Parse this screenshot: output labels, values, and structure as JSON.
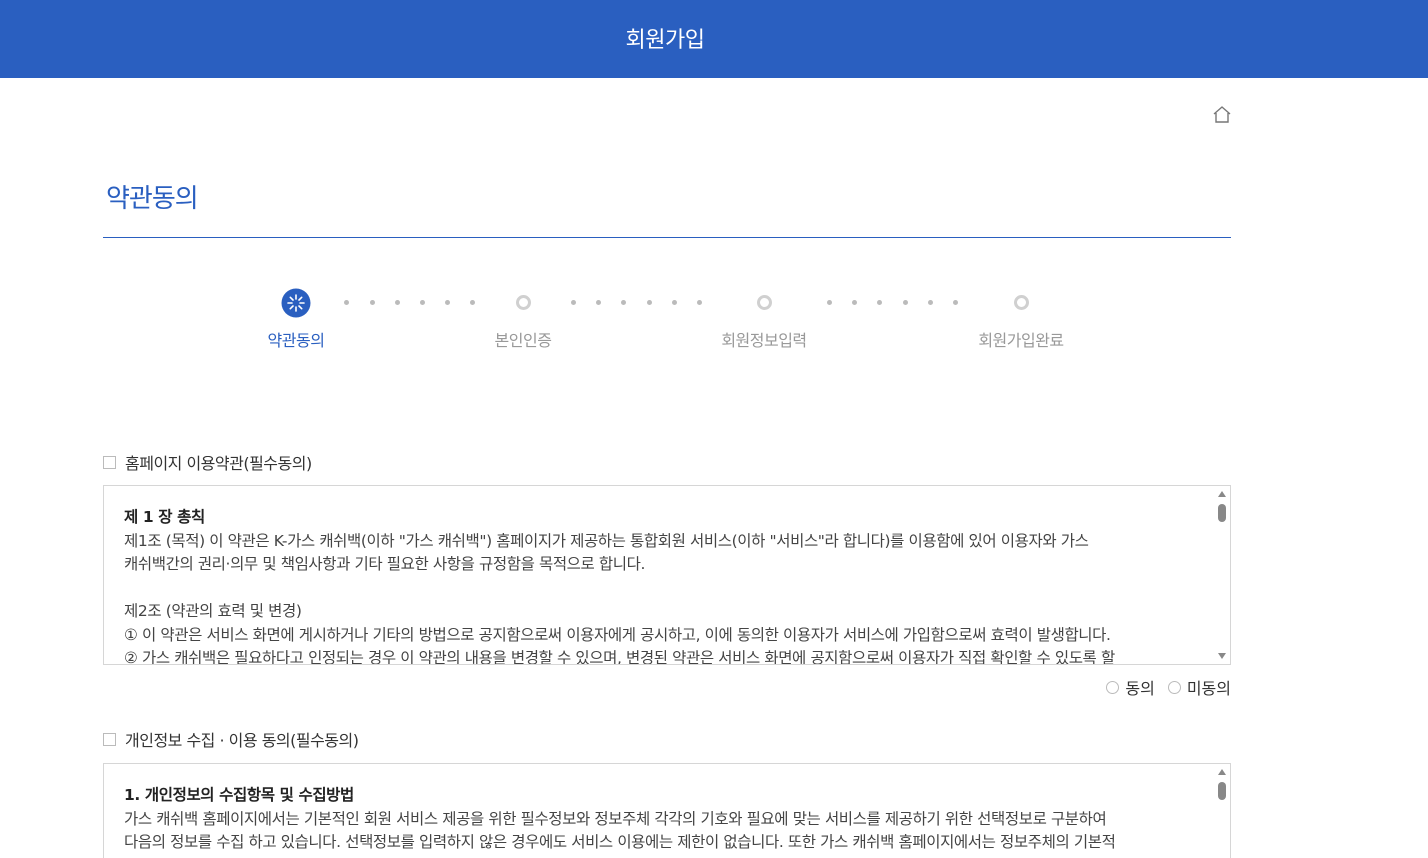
{
  "header": {
    "title": "회원가입"
  },
  "page": {
    "title": "약관동의"
  },
  "steps": [
    {
      "label": "약관동의",
      "active": true
    },
    {
      "label": "본인인증",
      "active": false
    },
    {
      "label": "회원정보입력",
      "active": false
    },
    {
      "label": "회원가입완료",
      "active": false
    }
  ],
  "terms1": {
    "label": "홈페이지 이용약관(필수동의)",
    "lines": [
      "제 1 장 총칙",
      "제1조 (목적) 이 약관은 K-가스 캐쉬백(이하 \"가스 캐쉬백\") 홈페이지가 제공하는 통합회원 서비스(이하 \"서비스\"라 합니다)를 이용함에 있어 이용자와 가스",
      "캐쉬백간의 권리·의무 및 책임사항과 기타 필요한 사항을 규정함을 목적으로 합니다.",
      "",
      "제2조 (약관의 효력 및 변경)",
      "① 이 약관은 서비스 화면에 게시하거나 기타의 방법으로 공지함으로써 이용자에게 공시하고, 이에 동의한 이용자가 서비스에 가입함으로써 효력이 발생합니다.",
      "② 가스 캐쉬백은 필요하다고 인정되는 경우 이 약관의 내용을 변경할 수 있으며, 변경된 약관은 서비스 화면에 공지함으로써 이용자가 직접 확인할 수 있도록 할"
    ],
    "agree": "동의",
    "disagree": "미동의"
  },
  "terms2": {
    "label": "개인정보 수집 · 이용 동의(필수동의)",
    "lines": [
      "1. 개인정보의 수집항목 및 수집방법",
      "가스 캐쉬백 홈페이지에서는 기본적인 회원 서비스 제공을 위한 필수정보와 정보주체 각각의 기호와 필요에 맞는 서비스를 제공하기 위한 선택정보로 구분하여",
      "다음의 정보를 수집 하고 있습니다. 선택정보를 입력하지 않은 경우에도 서비스 이용에는 제한이 없습니다. 또한 가스 캐쉬백 홈페이지에서는 정보주체의 기본적"
    ]
  }
}
